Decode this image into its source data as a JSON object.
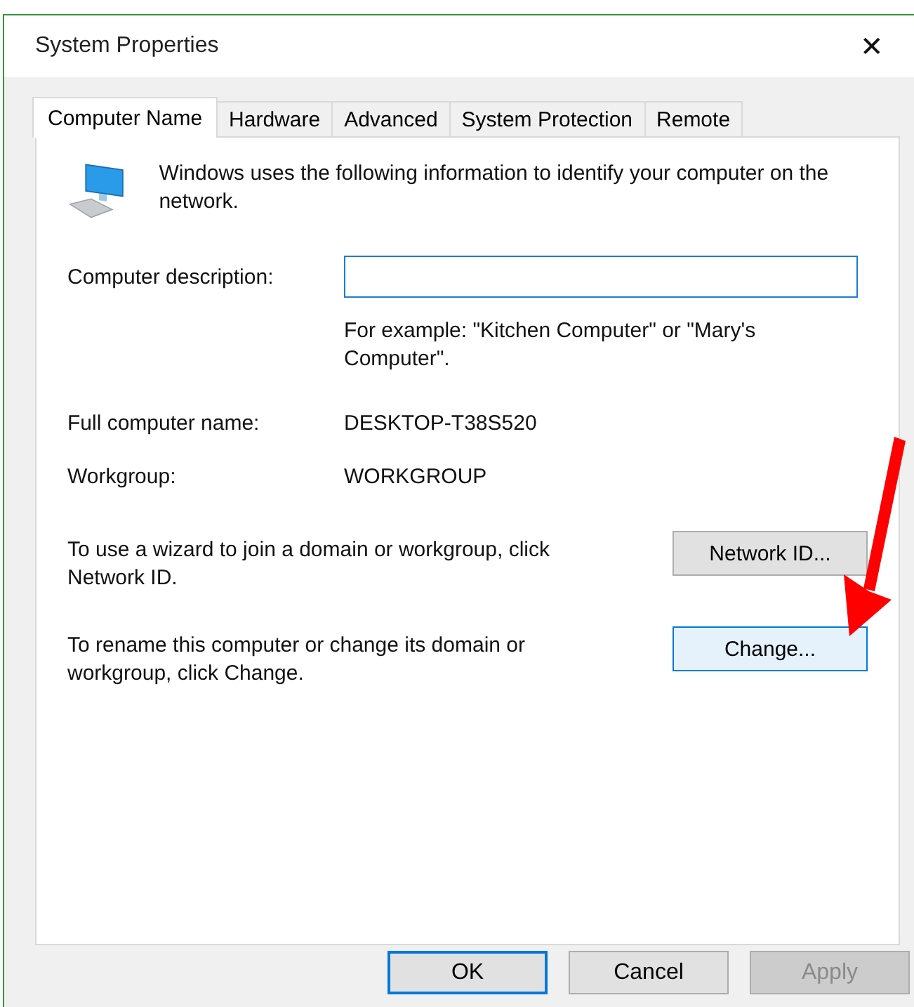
{
  "window": {
    "title": "System Properties",
    "close": "✕"
  },
  "tabs": [
    {
      "label": "Computer Name",
      "selected": true
    },
    {
      "label": "Hardware",
      "selected": false
    },
    {
      "label": "Advanced",
      "selected": false
    },
    {
      "label": "System Protection",
      "selected": false
    },
    {
      "label": "Remote",
      "selected": false
    }
  ],
  "intro": "Windows uses the following information to identify your computer on the network.",
  "description": {
    "label": "Computer description:",
    "example": "For example: \"Kitchen Computer\" or \"Mary's Computer\"."
  },
  "fields": [
    {
      "label": "Full computer name:",
      "value": "DESKTOP-T38S520"
    },
    {
      "label": "Workgroup:",
      "value": "WORKGROUP"
    }
  ],
  "actions": [
    {
      "text": "To use a wizard to join a domain or workgroup, click Network ID.",
      "button": "Network ID...",
      "highlighted": false
    },
    {
      "text": "To rename this computer or change its domain or workgroup, click Change.",
      "button": "Change...",
      "highlighted": true
    }
  ],
  "buttons": [
    {
      "label": "OK",
      "default": true,
      "disabled": false
    },
    {
      "label": "Cancel",
      "default": false,
      "disabled": false
    },
    {
      "label": "Apply",
      "default": false,
      "disabled": true
    }
  ]
}
